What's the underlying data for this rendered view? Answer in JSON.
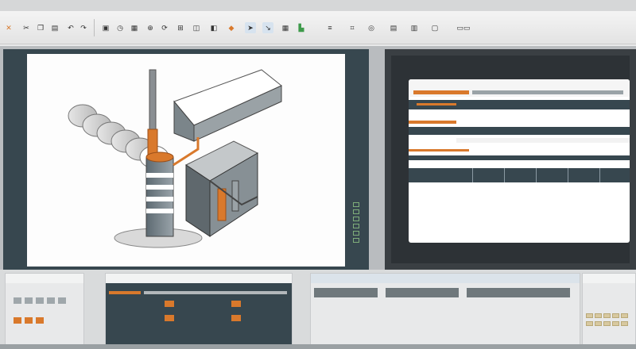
{
  "toolbar": {
    "icons": [
      "app-icon",
      "cut-icon",
      "copy-icon",
      "paste-icon",
      "undo-icon",
      "redo-icon",
      "save-icon",
      "open-icon",
      "print-icon",
      "zoom-icon",
      "rotate-icon",
      "measure-icon",
      "layer-icon",
      "view-icon",
      "settings-icon"
    ]
  },
  "colors": {
    "accent": "#d9792c",
    "panel_dark": "#37474f",
    "canvas": "#fdfdfd"
  }
}
